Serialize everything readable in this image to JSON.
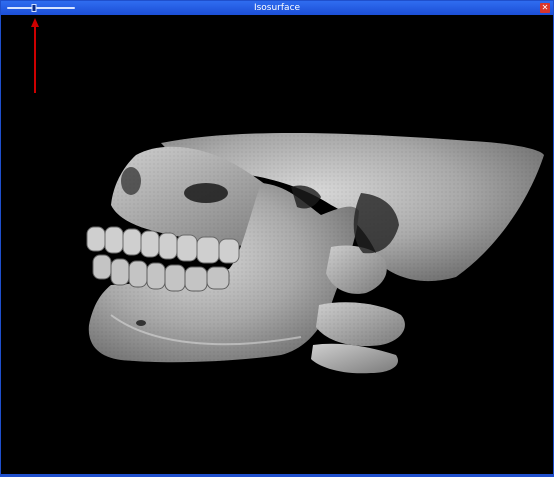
{
  "window": {
    "title": "Isosurface",
    "close_icon": "close-icon",
    "accent_color": "#1c4fd6"
  },
  "controls": {
    "isovalue_slider": {
      "level": 0.4
    }
  },
  "viewport": {
    "background": "#000000",
    "orientation_arrow_color": "#cc0000",
    "render_subject": "skull-isosurface"
  }
}
